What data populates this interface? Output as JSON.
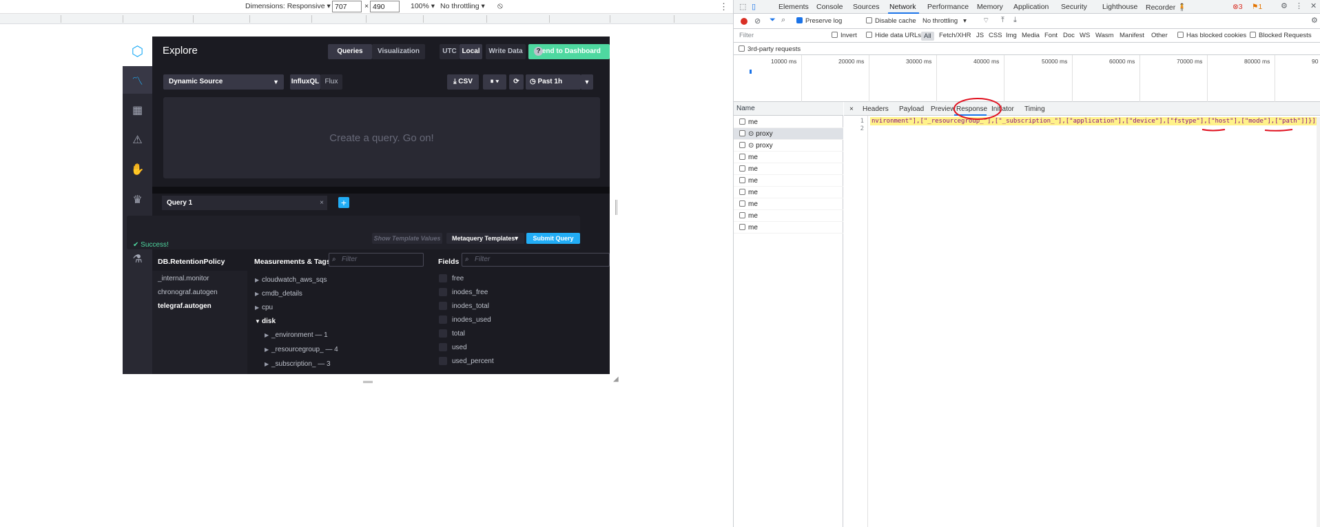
{
  "device_toolbar": {
    "dimensions_label": "Dimensions: Responsive ▾",
    "width_value": "707",
    "times": "×",
    "height_value": "490",
    "zoom": "100% ▾",
    "throttle": "No throttling ▾",
    "rotate_icon": "⦸",
    "more_icon": "⋮"
  },
  "app": {
    "logo_icon": "⬡",
    "nav_icons": [
      "〽",
      "▦",
      "⚠",
      "✋",
      "♛",
      "🔧",
      "⚗"
    ],
    "title": "Explore",
    "view_toggle": [
      "Queries",
      "Visualization"
    ],
    "help": "?",
    "tz_toggle": [
      "UTC",
      "Local"
    ],
    "write_data": "Write Data",
    "send_to_dashboard": "Send to Dashboard",
    "source_dropdown": "Dynamic Source",
    "lang_toggle": [
      "InfluxQL",
      "Flux"
    ],
    "csv": "⤓ CSV",
    "pause": "⏸ ▾",
    "refresh": "⟳",
    "time_range": "◷ Past 1h",
    "placeholder": "Create a query. Go on!",
    "query_tab": "Query 1",
    "query_tab_close": "×",
    "add_query": "+",
    "success": "✔ Success!",
    "show_template_values": "Show Template Values",
    "metaquery_templates": "Metaquery Templates",
    "submit_query": "Submit Query",
    "schema": {
      "db_header": "DB.RetentionPolicy",
      "meas_header": "Measurements & Tags",
      "fields_header": "Fields",
      "filter_placeholder": "Filter",
      "databases": [
        "_internal.monitor",
        "chronograf.autogen",
        "telegraf.autogen"
      ],
      "measurements": [
        "cloudwatch_aws_sqs",
        "cmdb_details",
        "cpu",
        "disk"
      ],
      "tags": [
        "_environment — 1",
        "_resourcegroup_ — 4",
        "_subscription_ — 3"
      ],
      "fields": [
        "free",
        "inodes_free",
        "inodes_total",
        "inodes_used",
        "total",
        "used",
        "used_percent"
      ]
    }
  },
  "devtools": {
    "tabs": [
      "Elements",
      "Console",
      "Sources",
      "Network",
      "Performance",
      "Memory",
      "Application",
      "Security",
      "Lighthouse",
      "Recorder 🧍"
    ],
    "errors_badge": "⊗3",
    "warnings_badge": "⚑1",
    "toolbar": {
      "preserve_log": "Preserve log",
      "disable_cache": "Disable cache",
      "throttling": "No throttling"
    },
    "filter_bar": {
      "placeholder": "Filter",
      "invert": "Invert",
      "hide_data_urls": "Hide data URLs",
      "types": [
        "All",
        "Fetch/XHR",
        "JS",
        "CSS",
        "Img",
        "Media",
        "Font",
        "Doc",
        "WS",
        "Wasm",
        "Manifest",
        "Other"
      ],
      "blocked_cookies": "Has blocked cookies",
      "blocked_requests": "Blocked Requests",
      "third_party": "3rd-party requests"
    },
    "timeline_labels": [
      "10000 ms",
      "20000 ms",
      "30000 ms",
      "40000 ms",
      "50000 ms",
      "60000 ms",
      "70000 ms",
      "80000 ms",
      "90"
    ],
    "name_header": "Name",
    "requests": [
      "me",
      "⊙ proxy",
      "⊙ proxy",
      "me",
      "me",
      "me",
      "me",
      "me",
      "me",
      "me"
    ],
    "detail_tabs": [
      "×",
      "Headers",
      "Payload",
      "Preview",
      "Response",
      "Initiator",
      "Timing"
    ],
    "line_numbers": [
      "1",
      "2"
    ],
    "response_text": "nvironment\"],[\"_resourcegroup_\"],[\"_subscription_\"],[\"application\"],[\"device\"],[\"fstype\"],[\"host\"],[\"mode\"],[\"path\"]]}]},"
  },
  "colors": {
    "app_bg": "#1b1b22",
    "accent_blue": "#22adf6",
    "accent_green": "#4ed8a0",
    "devtools_blue": "#1a73e8",
    "annotation_red": "#e0101e",
    "response_highlight": "#fff28a"
  }
}
